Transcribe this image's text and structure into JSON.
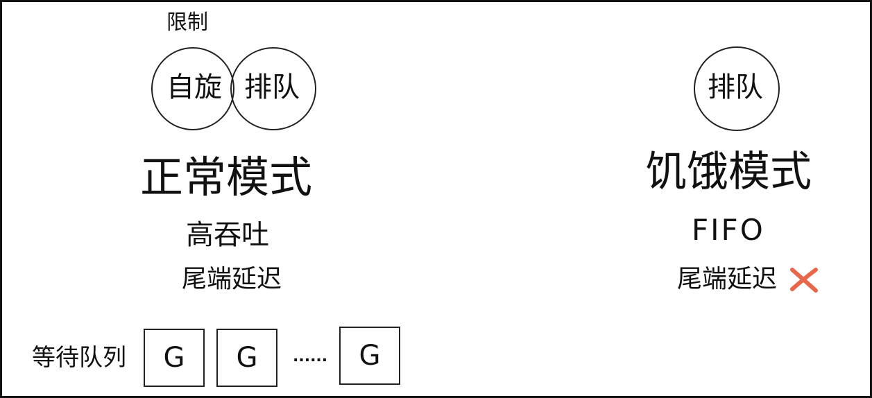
{
  "normal_mode": {
    "limit_label": "限制",
    "venn_left": "自旋",
    "venn_right": "排队",
    "title": "正常模式",
    "pro": "高吞吐",
    "con": "尾端延迟"
  },
  "starvation_mode": {
    "circle_label": "排队",
    "title": "饥饿模式",
    "subtitle": "FIFO",
    "con": "尾端延迟",
    "con_mark": "cross-icon",
    "con_mark_color": "#e8674a"
  },
  "waiting_queue": {
    "label": "等待队列",
    "items": [
      "G",
      "G",
      "G"
    ],
    "ellipsis": "......"
  }
}
